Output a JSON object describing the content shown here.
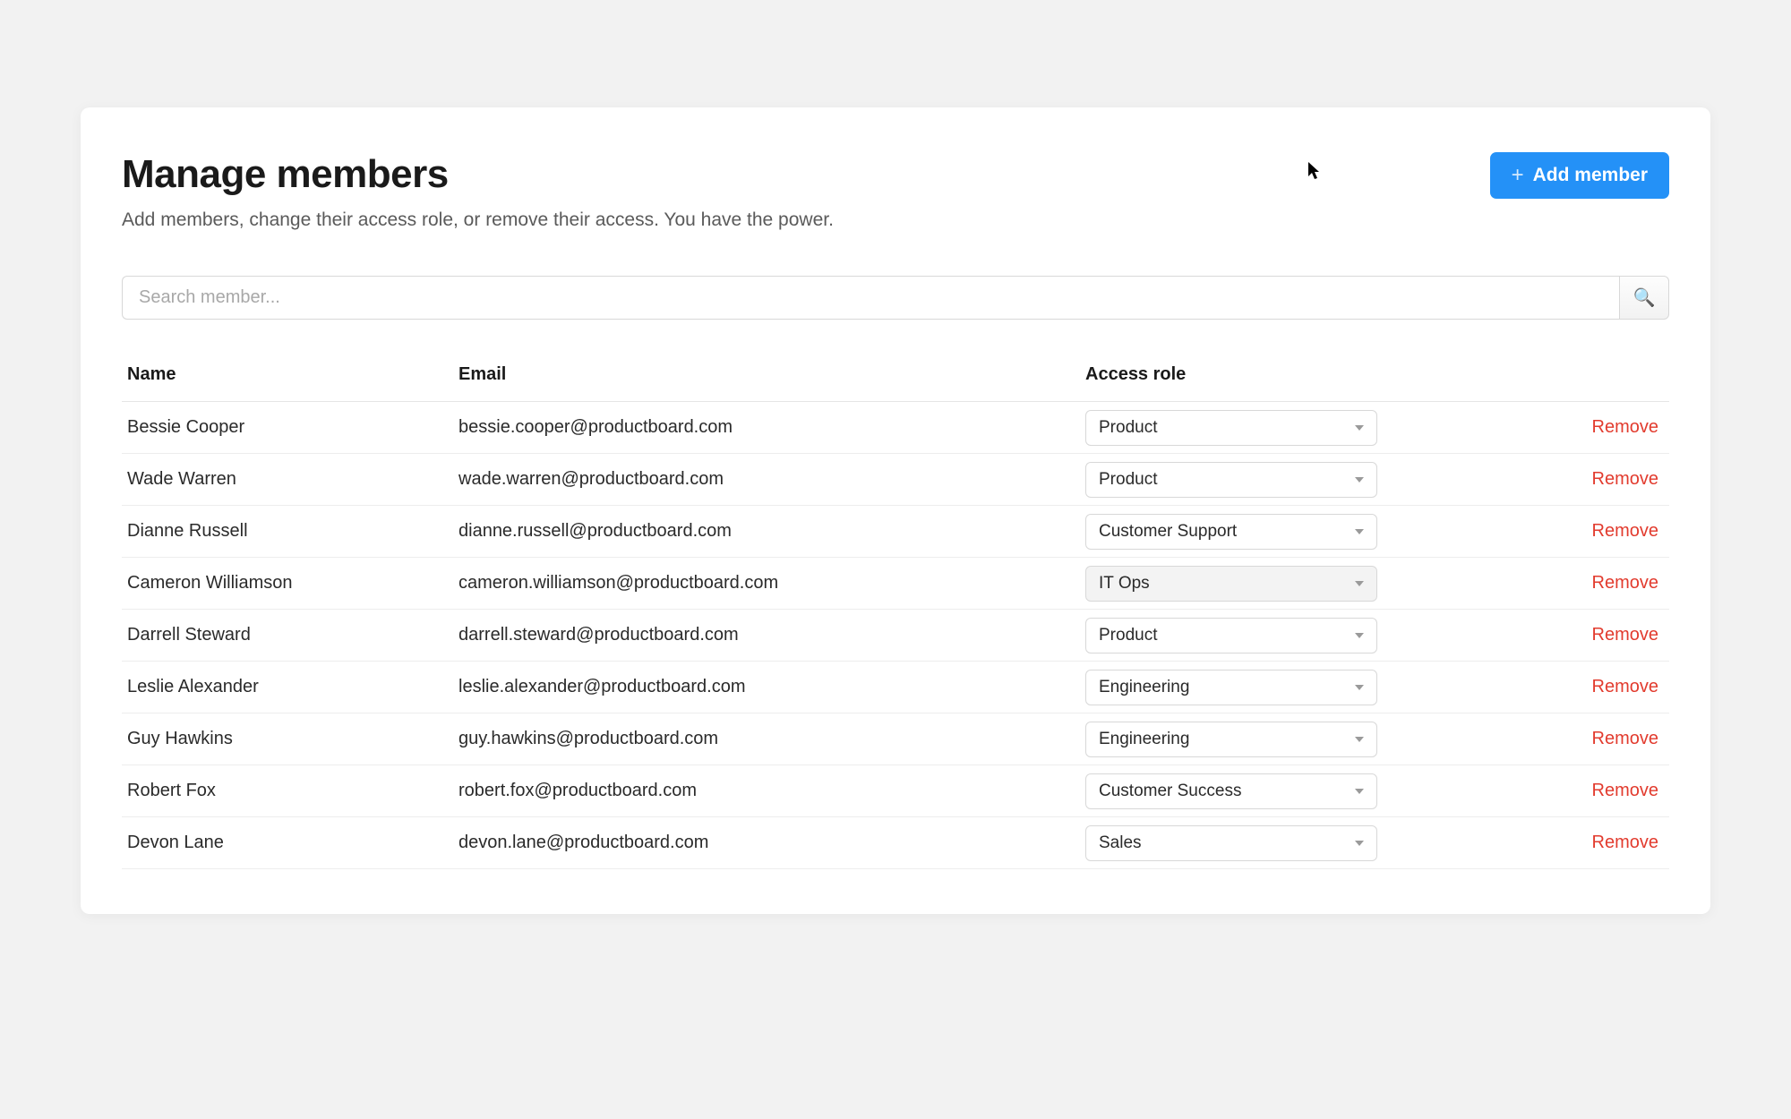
{
  "header": {
    "title": "Manage members",
    "subtitle": "Add members, change their access role, or remove their access. You have the power.",
    "add_button_label": "Add member"
  },
  "search": {
    "placeholder": "Search member...",
    "value": ""
  },
  "table": {
    "columns": {
      "name": "Name",
      "email": "Email",
      "role": "Access role"
    },
    "remove_label": "Remove",
    "rows": [
      {
        "name": "Bessie Cooper",
        "email": "bessie.cooper@productboard.com",
        "role": "Product",
        "hover": false
      },
      {
        "name": "Wade Warren",
        "email": "wade.warren@productboard.com",
        "role": "Product",
        "hover": false
      },
      {
        "name": "Dianne Russell",
        "email": "dianne.russell@productboard.com",
        "role": "Customer Support",
        "hover": false
      },
      {
        "name": "Cameron Williamson",
        "email": "cameron.williamson@productboard.com",
        "role": "IT Ops",
        "hover": true
      },
      {
        "name": "Darrell Steward",
        "email": "darrell.steward@productboard.com",
        "role": "Product",
        "hover": false
      },
      {
        "name": "Leslie Alexander",
        "email": "leslie.alexander@productboard.com",
        "role": "Engineering",
        "hover": false
      },
      {
        "name": "Guy Hawkins",
        "email": "guy.hawkins@productboard.com",
        "role": "Engineering",
        "hover": false
      },
      {
        "name": "Robert Fox",
        "email": "robert.fox@productboard.com",
        "role": "Customer Success",
        "hover": false
      },
      {
        "name": "Devon Lane",
        "email": "devon.lane@productboard.com",
        "role": "Sales",
        "hover": false
      }
    ]
  }
}
